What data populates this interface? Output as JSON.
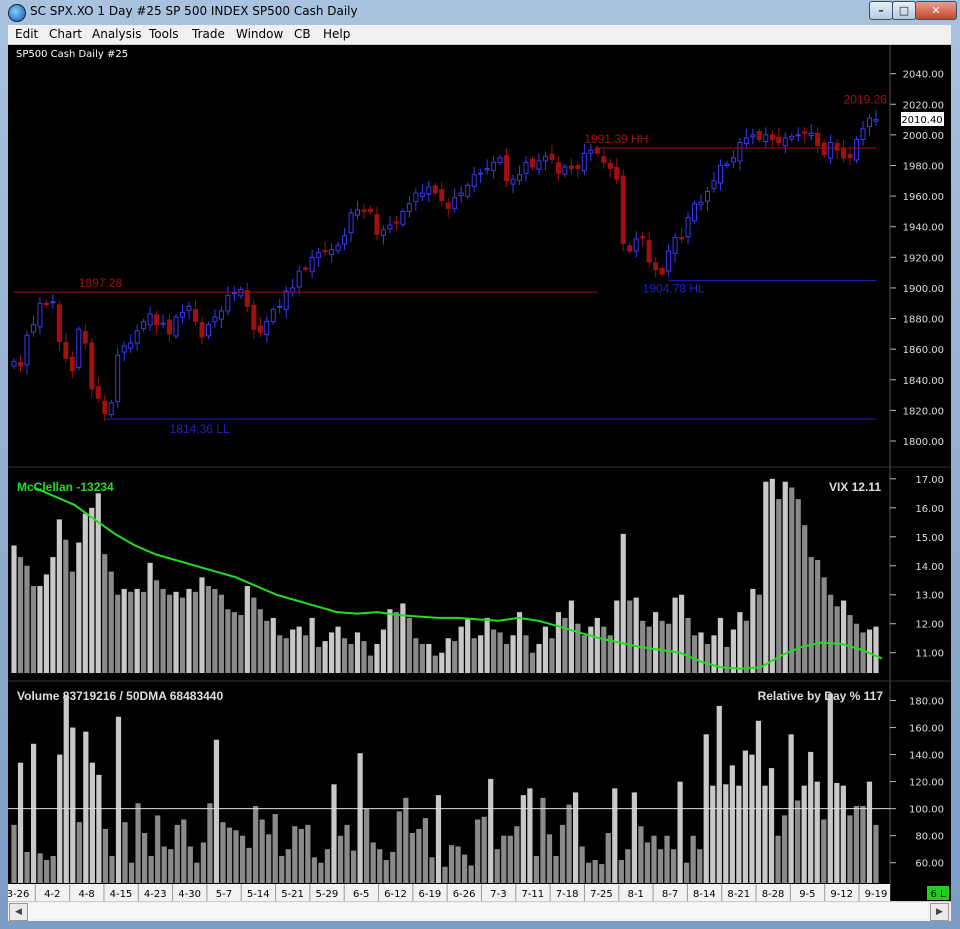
{
  "window": {
    "title": "SC SPX.XO  1 Day   #25  SP 500 INDEX  SP500 Cash Daily",
    "controls": {
      "minimize": "–",
      "maximize": "□",
      "close": "✕"
    }
  },
  "menu": [
    "Edit",
    "Chart",
    "Analysis",
    "Tools",
    "Trade",
    "Window",
    "CB",
    "Help"
  ],
  "colors": {
    "background": "#000000",
    "up_candle": "#3a3af0",
    "down_candle": "#a01010",
    "resistance": "#a01010",
    "support": "#2020c8",
    "mcclellan": "#22dd22",
    "bars_light": "#c8c8c8",
    "bars_dark": "#8a8a8a",
    "status_green": "#1fd11f"
  },
  "price_panel": {
    "label": "SP500 Cash Daily #25",
    "current_price": "2010.40",
    "price_axis_ticks": [
      "2040.00",
      "2020.00",
      "2000.00",
      "1980.00",
      "1960.00",
      "1940.00",
      "1920.00",
      "1900.00",
      "1880.00",
      "1860.00",
      "1840.00",
      "1820.00",
      "1800.00"
    ],
    "annotations": [
      {
        "text": "1897.28",
        "level": 1897.28
      },
      {
        "text": "1814.36 LL",
        "level": 1814.36
      },
      {
        "text": "1991.39 HH",
        "level": 1991.39
      },
      {
        "text": "1904.78 HL",
        "level": 1904.78
      },
      {
        "text": "2019.26",
        "level": 2019.26
      }
    ]
  },
  "mcclellan_panel": {
    "label": "McClellan -13234",
    "vix_label": "VIX 12.11",
    "axis_ticks": [
      "17.00",
      "16.00",
      "15.00",
      "14.00",
      "13.00",
      "12.00",
      "11.00"
    ]
  },
  "volume_panel": {
    "label": "Volume 83719216 / 50DMA 68483440",
    "relative_label": "Relative by Day % 117",
    "axis_ticks": [
      "180.00",
      "160.00",
      "140.00",
      "120.00",
      "100.00",
      "80.00",
      "60.00"
    ]
  },
  "date_axis": [
    "3-26",
    "4-2",
    "4-8",
    "4-15",
    "4-23",
    "4-30",
    "5-7",
    "5-14",
    "5-21",
    "5-29",
    "6-5",
    "6-12",
    "6-19",
    "6-26",
    "7-3",
    "7-11",
    "7-18",
    "7-25",
    "8-1",
    "8-7",
    "8-14",
    "8-21",
    "8-28",
    "9-5",
    "9-12",
    "9-19"
  ],
  "status_badge": "6 L",
  "scroll": {
    "left": "◀",
    "right": "▶"
  },
  "chart_data": [
    {
      "type": "candlestick",
      "title": "SP500 Cash Daily #25",
      "ylim": [
        1800,
        2045
      ],
      "close": [
        1852,
        1849,
        1869,
        1876,
        1890,
        1889,
        1891,
        1865,
        1854,
        1846,
        1873,
        1864,
        1834,
        1828,
        1818,
        1825,
        1856,
        1862,
        1864,
        1872,
        1878,
        1883,
        1876,
        1877,
        1870,
        1881,
        1884,
        1888,
        1878,
        1868,
        1876,
        1881,
        1885,
        1895,
        1897,
        1899,
        1888,
        1873,
        1871,
        1878,
        1886,
        1888,
        1898,
        1900,
        1911,
        1912,
        1920,
        1923,
        1924,
        1925,
        1928,
        1934,
        1949,
        1951,
        1950,
        1950,
        1935,
        1938,
        1941,
        1943,
        1950,
        1955,
        1962,
        1962,
        1966,
        1962,
        1957,
        1952,
        1959,
        1962,
        1967,
        1974,
        1975,
        1978,
        1982,
        1985,
        1970,
        1971,
        1974,
        1982,
        1979,
        1983,
        1986,
        1984,
        1975,
        1979,
        1978,
        1978,
        1988,
        1990,
        1988,
        1982,
        1978,
        1971,
        1929,
        1924,
        1932,
        1933,
        1917,
        1912,
        1909,
        1924,
        1933,
        1932,
        1946,
        1955,
        1956,
        1963,
        1970,
        1980,
        1981,
        1985,
        1995,
        1998,
        2000,
        1997,
        2000,
        1997,
        1995,
        1998,
        1999,
        2000,
        2001,
        2001,
        1993,
        1987,
        1995,
        1990,
        1985,
        1985,
        1997,
        2004,
        2011,
        2010
      ],
      "support_levels": [
        1814.36,
        1904.78
      ],
      "resistance_levels": [
        1897.28,
        1991.39
      ],
      "last_price": 2010.4
    },
    {
      "type": "bar",
      "title": "VIX",
      "ylim": [
        10.3,
        17.2
      ],
      "values": [
        14.7,
        14.3,
        14.0,
        13.3,
        13.3,
        13.7,
        14.3,
        15.6,
        14.9,
        13.8,
        14.8,
        15.8,
        16.0,
        16.5,
        14.4,
        13.8,
        13.0,
        13.2,
        13.1,
        13.2,
        13.1,
        14.1,
        13.5,
        13.2,
        13.0,
        13.1,
        12.9,
        13.2,
        13.1,
        13.6,
        13.3,
        13.2,
        13.0,
        12.5,
        12.4,
        12.3,
        13.3,
        12.9,
        12.5,
        12.1,
        12.2,
        11.6,
        11.5,
        11.8,
        11.9,
        11.6,
        12.2,
        11.2,
        11.4,
        11.7,
        11.9,
        11.5,
        11.3,
        11.7,
        11.4,
        10.9,
        11.3,
        11.8,
        12.5,
        12.4,
        12.7,
        12.2,
        11.5,
        11.3,
        11.3,
        10.9,
        11.0,
        11.5,
        11.4,
        11.9,
        12.2,
        11.5,
        11.6,
        12.2,
        11.8,
        11.7,
        11.3,
        11.6,
        12.4,
        11.6,
        11.0,
        11.3,
        11.9,
        11.5,
        12.4,
        12.2,
        12.8,
        12.0,
        11.6,
        11.9,
        12.2,
        11.9,
        11.6,
        12.8,
        15.1,
        12.8,
        12.9,
        12.1,
        11.9,
        12.4,
        12.1,
        12.0,
        12.9,
        13.0,
        12.2,
        11.6,
        11.7,
        11.3,
        11.6,
        12.2,
        11.2,
        11.8,
        12.4,
        12.1,
        13.2,
        13.0,
        16.9,
        17.0,
        16.3,
        16.9,
        16.7,
        16.3,
        15.4,
        14.3,
        14.2,
        13.6,
        13.0,
        12.6,
        12.8,
        12.3,
        12.0,
        11.7,
        11.8,
        11.9
      ],
      "series": [
        {
          "name": "McClellan -13234",
          "type": "line"
        }
      ]
    },
    {
      "type": "bar",
      "title": "Volume 83719216 / 50DMA 68483440",
      "ylim": [
        45,
        190
      ],
      "reference_line": 100,
      "values": [
        88,
        134,
        68,
        148,
        67,
        62,
        65,
        140,
        184,
        160,
        90,
        157,
        134,
        125,
        85,
        65,
        168,
        90,
        60,
        104,
        82,
        65,
        95,
        72,
        70,
        88,
        92,
        72,
        60,
        75,
        104,
        151,
        90,
        86,
        84,
        80,
        71,
        102,
        92,
        81,
        96,
        65,
        70,
        87,
        85,
        88,
        64,
        60,
        70,
        118,
        80,
        88,
        69,
        141,
        100,
        75,
        70,
        62,
        68,
        98,
        108,
        82,
        85,
        93,
        64,
        110,
        57,
        73,
        72,
        66,
        58,
        92,
        94,
        122,
        70,
        80,
        80,
        87,
        110,
        115,
        65,
        108,
        81,
        65,
        88,
        103,
        112,
        72,
        60,
        62,
        59,
        82,
        115,
        62,
        70,
        112,
        87,
        75,
        80,
        70,
        80,
        70,
        120,
        60,
        80,
        70,
        155,
        117,
        176,
        118,
        132,
        117,
        143,
        140,
        165,
        117,
        130,
        80,
        95,
        155,
        106,
        117,
        142,
        120,
        92,
        185,
        119,
        117,
        95,
        102,
        102,
        120,
        88
      ]
    }
  ]
}
